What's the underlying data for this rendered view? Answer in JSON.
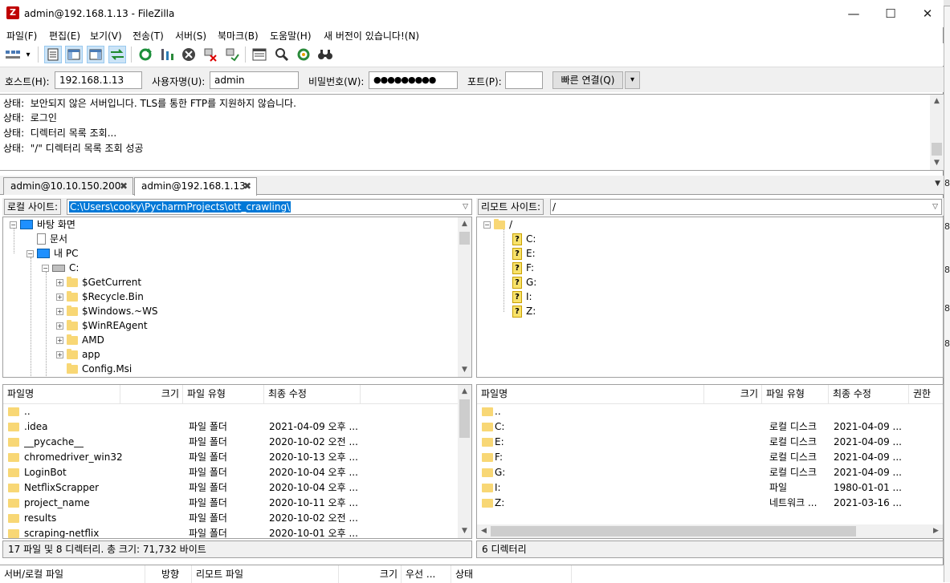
{
  "window": {
    "title": "admin@192.168.1.13 - FileZilla",
    "app_icon": "Z",
    "min": "—",
    "max": "☐",
    "close": "✕"
  },
  "menu": [
    "파일(F)",
    "편집(E)",
    "보기(V)",
    "전송(T)",
    "서버(S)",
    "북마크(B)",
    "도움말(H)",
    "새 버전이 있습니다!(N)"
  ],
  "toolbar": {
    "site_manager_icon": "site-manager-icon",
    "dropdown_arrow": "▾",
    "buttons": [
      "message-log-icon",
      "local-tree-icon",
      "remote-tree-icon",
      "transfer-queue-icon",
      "refresh-icon",
      "process-queue-icon",
      "cancel-icon",
      "disconnect-icon",
      "reconnect-icon",
      "filter-icon",
      "compare-icon",
      "sync-browse-icon",
      "search-icon"
    ]
  },
  "quickconnect": {
    "host_label": "호스트(H):",
    "host_value": "192.168.1.13",
    "user_label": "사용자명(U):",
    "user_value": "admin",
    "pass_label": "비밀번호(W):",
    "pass_value": "●●●●●●●●●",
    "port_label": "포트(P):",
    "port_value": "",
    "connect_label": "빠른 연결(Q)",
    "dropdown": "▾"
  },
  "log": [
    {
      "prefix": "상태:",
      "text": "보안되지 않은 서버입니다. TLS를 통한 FTP를 지원하지 않습니다."
    },
    {
      "prefix": "상태:",
      "text": "로그인"
    },
    {
      "prefix": "상태:",
      "text": "디렉터리 목록 조회..."
    },
    {
      "prefix": "상태:",
      "text": "\"/\" 디렉터리 목록 조회 성공"
    }
  ],
  "tabs": [
    {
      "label": "admin@10.10.150.200",
      "close": "✖"
    },
    {
      "label": "admin@192.168.1.13",
      "close": "✖"
    }
  ],
  "tab_dropdown": "▼",
  "local": {
    "label": "로컬 사이트:",
    "path": "C:\\Users\\cooky\\PycharmProjects\\ott_crawling\\",
    "tree": [
      {
        "label": "바탕 화면"
      },
      {
        "label": "문서"
      },
      {
        "label": "내 PC"
      },
      {
        "label": "C:"
      },
      {
        "label": "$GetCurrent"
      },
      {
        "label": "$Recycle.Bin"
      },
      {
        "label": "$Windows.~WS"
      },
      {
        "label": "$WinREAgent"
      },
      {
        "label": "AMD"
      },
      {
        "label": "app"
      },
      {
        "label": "Config.Msi"
      }
    ],
    "columns": [
      "파일명",
      "크기",
      "파일 유형",
      "최종 수정"
    ],
    "files": [
      {
        "name": "..",
        "type": "",
        "modified": ""
      },
      {
        "name": ".idea",
        "type": "파일 폴더",
        "modified": "2021-04-09 오후 ..."
      },
      {
        "name": "__pycache__",
        "type": "파일 폴더",
        "modified": "2020-10-02 오전 ..."
      },
      {
        "name": "chromedriver_win32",
        "type": "파일 폴더",
        "modified": "2020-10-13 오후 ..."
      },
      {
        "name": "LoginBot",
        "type": "파일 폴더",
        "modified": "2020-10-04 오후 ..."
      },
      {
        "name": "NetflixScrapper",
        "type": "파일 폴더",
        "modified": "2020-10-04 오후 ..."
      },
      {
        "name": "project_name",
        "type": "파일 폴더",
        "modified": "2020-10-11 오후 ..."
      },
      {
        "name": "results",
        "type": "파일 폴더",
        "modified": "2020-10-02 오전 ..."
      },
      {
        "name": "scraping-netflix",
        "type": "파일 폴더",
        "modified": "2020-10-01 오후 ..."
      }
    ],
    "status": "17 파일 및 8 디렉터리. 총 크기: 71,732 바이트"
  },
  "remote": {
    "label": "리모트 사이트:",
    "path": "/",
    "tree": [
      {
        "label": "/"
      },
      {
        "label": "C:"
      },
      {
        "label": "E:"
      },
      {
        "label": "F:"
      },
      {
        "label": "G:"
      },
      {
        "label": "I:"
      },
      {
        "label": "Z:"
      }
    ],
    "columns": [
      "파일명",
      "크기",
      "파일 유형",
      "최종 수정",
      "권한"
    ],
    "files": [
      {
        "name": "..",
        "type": "",
        "modified": ""
      },
      {
        "name": "C:",
        "type": "로컬 디스크",
        "modified": "2021-04-09 ..."
      },
      {
        "name": "E:",
        "type": "로컬 디스크",
        "modified": "2021-04-09 ..."
      },
      {
        "name": "F:",
        "type": "로컬 디스크",
        "modified": "2021-04-09 ..."
      },
      {
        "name": "G:",
        "type": "로컬 디스크",
        "modified": "2021-04-09 ..."
      },
      {
        "name": "I:",
        "type": "파일",
        "modified": "1980-01-01 ..."
      },
      {
        "name": "Z:",
        "type": "네트워크 ...",
        "modified": "2021-03-16 ..."
      }
    ],
    "status": "6 디렉터리"
  },
  "queue": {
    "columns": [
      "서버/로컬 파일",
      "방향",
      "리모트 파일",
      "크기",
      "우선 ...",
      "상태"
    ]
  },
  "behind_chars": [
    "8",
    "8",
    "8",
    "8",
    "8"
  ],
  "colors": {
    "accent": "#0078d7",
    "folder": "#f8d775",
    "panel": "#f0f0f0"
  }
}
